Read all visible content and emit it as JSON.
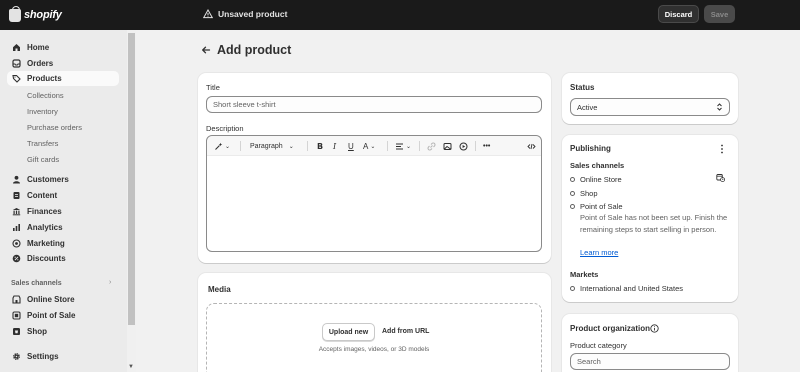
{
  "topbar": {
    "brand": "shopify",
    "status": "Unsaved product",
    "discard_label": "Discard",
    "save_label": "Save"
  },
  "sidebar": {
    "items": [
      {
        "label": "Home",
        "icon": "home-icon"
      },
      {
        "label": "Orders",
        "icon": "inbox-icon"
      },
      {
        "label": "Products",
        "icon": "tag-icon",
        "active": true
      },
      {
        "label": "Customers",
        "icon": "person-icon"
      },
      {
        "label": "Content",
        "icon": "document-icon"
      },
      {
        "label": "Finances",
        "icon": "bank-icon"
      },
      {
        "label": "Analytics",
        "icon": "chart-icon"
      },
      {
        "label": "Marketing",
        "icon": "target-icon"
      },
      {
        "label": "Discounts",
        "icon": "discount-icon"
      }
    ],
    "product_subitems": [
      "Collections",
      "Inventory",
      "Purchase orders",
      "Transfers",
      "Gift cards"
    ],
    "sales_channels_label": "Sales channels",
    "channels": [
      {
        "label": "Online Store",
        "icon": "store-icon"
      },
      {
        "label": "Point of Sale",
        "icon": "pos-icon"
      },
      {
        "label": "Shop",
        "icon": "shop-icon"
      }
    ],
    "settings_label": "Settings"
  },
  "page": {
    "title": "Add product"
  },
  "product_form": {
    "title_label": "Title",
    "title_placeholder": "Short sleeve t-shirt",
    "description_label": "Description",
    "toolbar": {
      "paragraph_label": "Paragraph",
      "bold": "B",
      "italic": "I",
      "underline": "U",
      "text_color": "A"
    }
  },
  "media": {
    "heading": "Media",
    "upload_label": "Upload new",
    "add_url_label": "Add from URL",
    "hint": "Accepts images, videos, or 3D models"
  },
  "status_card": {
    "heading": "Status",
    "value": "Active"
  },
  "publishing": {
    "heading": "Publishing",
    "sales_channels_label": "Sales channels",
    "channels": [
      "Online Store",
      "Shop",
      "Point of Sale"
    ],
    "pos_note": "Point of Sale has not been set up. Finish the remaining steps to start selling in person.",
    "learn_more": "Learn more",
    "markets_label": "Markets",
    "markets_value": "International and United States"
  },
  "organization": {
    "heading": "Product organization",
    "category_label": "Product category",
    "category_placeholder": "Search"
  },
  "colors": {
    "topbar": "#1a1a1a",
    "sidebar": "#ebebeb",
    "background": "#f1f1f1",
    "link": "#005bd3"
  }
}
